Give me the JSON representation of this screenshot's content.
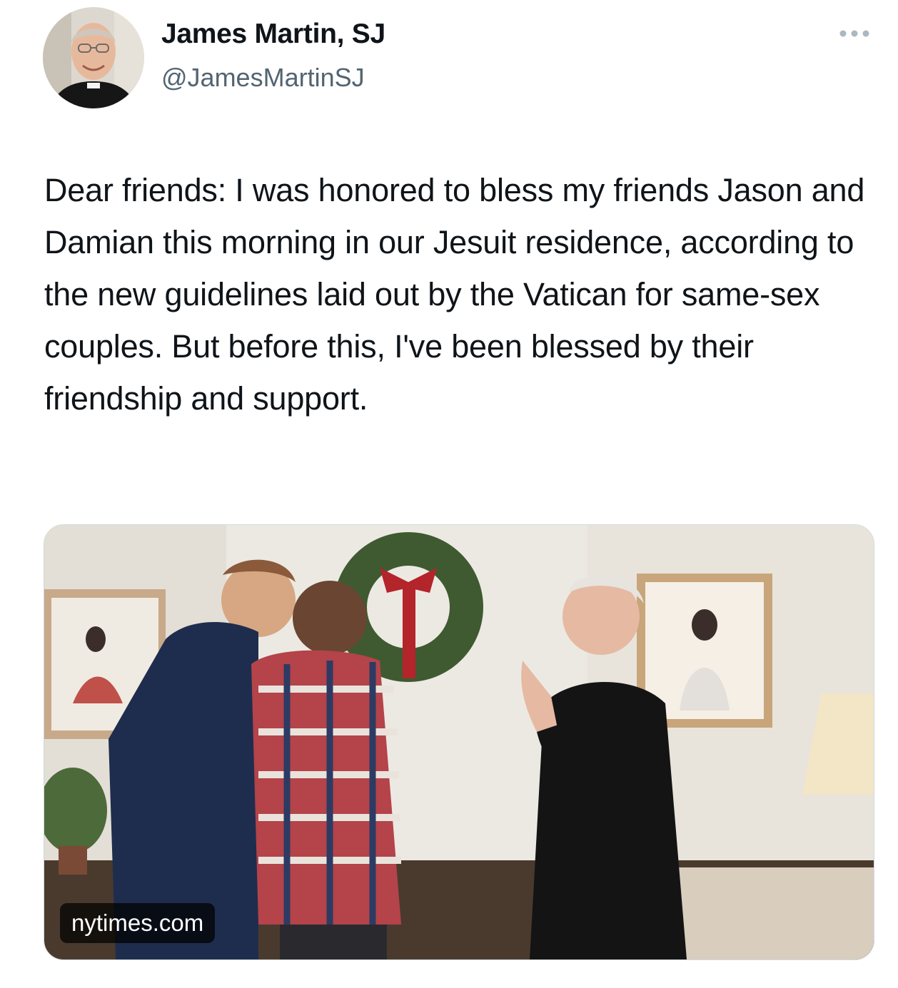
{
  "author": {
    "display_name": "James Martin, SJ",
    "handle": "@JamesMartinSJ"
  },
  "tweet": {
    "text": "Dear friends: I was honored to bless my friends Jason and Damian this morning in our Jesuit residence, according to the new guidelines laid out by the Vatican for same-sex couples. But before this, I've been blessed by their friendship and support."
  },
  "media_card": {
    "source_domain": "nytimes.com"
  },
  "icons": {
    "more": "more-horizontal-icon"
  },
  "colors": {
    "text_primary": "#0f1419",
    "text_secondary": "#536471",
    "card_border": "#cfd9de",
    "badge_bg": "#000000b8"
  }
}
